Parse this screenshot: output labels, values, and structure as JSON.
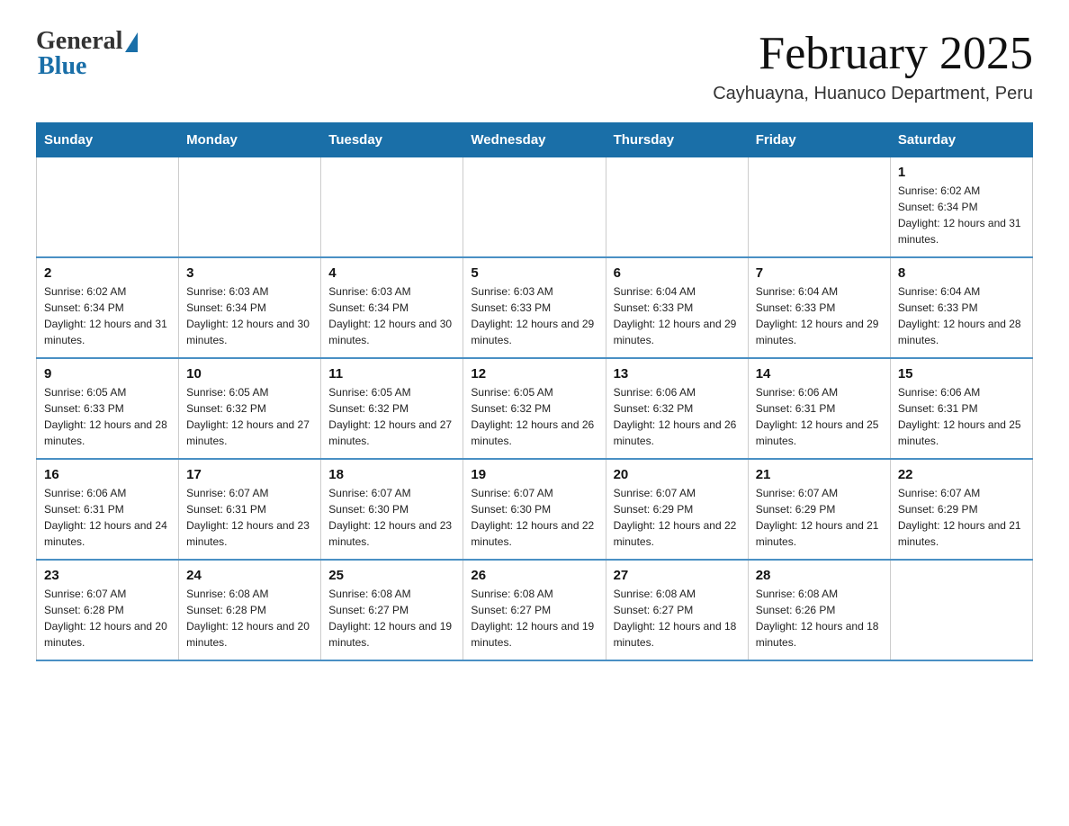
{
  "logo": {
    "general": "General",
    "blue": "Blue"
  },
  "header": {
    "month": "February 2025",
    "location": "Cayhuayna, Huanuco Department, Peru"
  },
  "days_of_week": [
    "Sunday",
    "Monday",
    "Tuesday",
    "Wednesday",
    "Thursday",
    "Friday",
    "Saturday"
  ],
  "weeks": [
    [
      {
        "day": "",
        "info": ""
      },
      {
        "day": "",
        "info": ""
      },
      {
        "day": "",
        "info": ""
      },
      {
        "day": "",
        "info": ""
      },
      {
        "day": "",
        "info": ""
      },
      {
        "day": "",
        "info": ""
      },
      {
        "day": "1",
        "info": "Sunrise: 6:02 AM\nSunset: 6:34 PM\nDaylight: 12 hours and 31 minutes."
      }
    ],
    [
      {
        "day": "2",
        "info": "Sunrise: 6:02 AM\nSunset: 6:34 PM\nDaylight: 12 hours and 31 minutes."
      },
      {
        "day": "3",
        "info": "Sunrise: 6:03 AM\nSunset: 6:34 PM\nDaylight: 12 hours and 30 minutes."
      },
      {
        "day": "4",
        "info": "Sunrise: 6:03 AM\nSunset: 6:34 PM\nDaylight: 12 hours and 30 minutes."
      },
      {
        "day": "5",
        "info": "Sunrise: 6:03 AM\nSunset: 6:33 PM\nDaylight: 12 hours and 29 minutes."
      },
      {
        "day": "6",
        "info": "Sunrise: 6:04 AM\nSunset: 6:33 PM\nDaylight: 12 hours and 29 minutes."
      },
      {
        "day": "7",
        "info": "Sunrise: 6:04 AM\nSunset: 6:33 PM\nDaylight: 12 hours and 29 minutes."
      },
      {
        "day": "8",
        "info": "Sunrise: 6:04 AM\nSunset: 6:33 PM\nDaylight: 12 hours and 28 minutes."
      }
    ],
    [
      {
        "day": "9",
        "info": "Sunrise: 6:05 AM\nSunset: 6:33 PM\nDaylight: 12 hours and 28 minutes."
      },
      {
        "day": "10",
        "info": "Sunrise: 6:05 AM\nSunset: 6:32 PM\nDaylight: 12 hours and 27 minutes."
      },
      {
        "day": "11",
        "info": "Sunrise: 6:05 AM\nSunset: 6:32 PM\nDaylight: 12 hours and 27 minutes."
      },
      {
        "day": "12",
        "info": "Sunrise: 6:05 AM\nSunset: 6:32 PM\nDaylight: 12 hours and 26 minutes."
      },
      {
        "day": "13",
        "info": "Sunrise: 6:06 AM\nSunset: 6:32 PM\nDaylight: 12 hours and 26 minutes."
      },
      {
        "day": "14",
        "info": "Sunrise: 6:06 AM\nSunset: 6:31 PM\nDaylight: 12 hours and 25 minutes."
      },
      {
        "day": "15",
        "info": "Sunrise: 6:06 AM\nSunset: 6:31 PM\nDaylight: 12 hours and 25 minutes."
      }
    ],
    [
      {
        "day": "16",
        "info": "Sunrise: 6:06 AM\nSunset: 6:31 PM\nDaylight: 12 hours and 24 minutes."
      },
      {
        "day": "17",
        "info": "Sunrise: 6:07 AM\nSunset: 6:31 PM\nDaylight: 12 hours and 23 minutes."
      },
      {
        "day": "18",
        "info": "Sunrise: 6:07 AM\nSunset: 6:30 PM\nDaylight: 12 hours and 23 minutes."
      },
      {
        "day": "19",
        "info": "Sunrise: 6:07 AM\nSunset: 6:30 PM\nDaylight: 12 hours and 22 minutes."
      },
      {
        "day": "20",
        "info": "Sunrise: 6:07 AM\nSunset: 6:29 PM\nDaylight: 12 hours and 22 minutes."
      },
      {
        "day": "21",
        "info": "Sunrise: 6:07 AM\nSunset: 6:29 PM\nDaylight: 12 hours and 21 minutes."
      },
      {
        "day": "22",
        "info": "Sunrise: 6:07 AM\nSunset: 6:29 PM\nDaylight: 12 hours and 21 minutes."
      }
    ],
    [
      {
        "day": "23",
        "info": "Sunrise: 6:07 AM\nSunset: 6:28 PM\nDaylight: 12 hours and 20 minutes."
      },
      {
        "day": "24",
        "info": "Sunrise: 6:08 AM\nSunset: 6:28 PM\nDaylight: 12 hours and 20 minutes."
      },
      {
        "day": "25",
        "info": "Sunrise: 6:08 AM\nSunset: 6:27 PM\nDaylight: 12 hours and 19 minutes."
      },
      {
        "day": "26",
        "info": "Sunrise: 6:08 AM\nSunset: 6:27 PM\nDaylight: 12 hours and 19 minutes."
      },
      {
        "day": "27",
        "info": "Sunrise: 6:08 AM\nSunset: 6:27 PM\nDaylight: 12 hours and 18 minutes."
      },
      {
        "day": "28",
        "info": "Sunrise: 6:08 AM\nSunset: 6:26 PM\nDaylight: 12 hours and 18 minutes."
      },
      {
        "day": "",
        "info": ""
      }
    ]
  ]
}
